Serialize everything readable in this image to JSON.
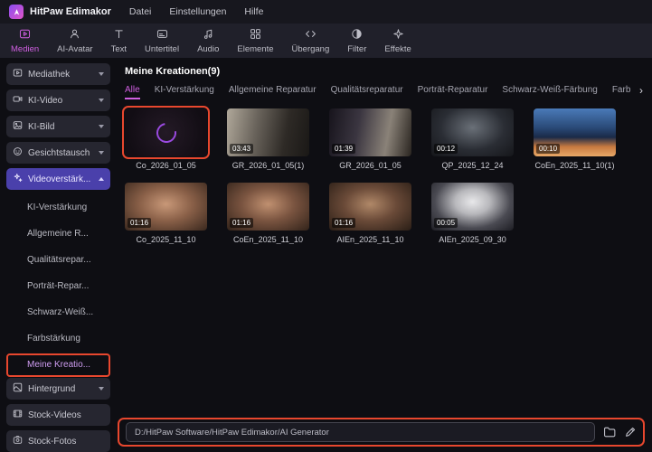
{
  "titlebar": {
    "app_name": "HitPaw Edimakor",
    "menus": [
      "Datei",
      "Einstellungen",
      "Hilfe"
    ]
  },
  "toolbar": {
    "tabs": [
      "Medien",
      "AI-Avatar",
      "Text",
      "Untertitel",
      "Audio",
      "Elemente",
      "Übergang",
      "Filter",
      "Effekte"
    ],
    "active_tab": "Medien"
  },
  "sidebar": {
    "items": [
      "Mediathek",
      "KI-Video",
      "KI-Bild",
      "Gesichtstausch",
      "Videoverstärk...",
      "Hintergrund",
      "Stock-Videos",
      "Stock-Fotos"
    ],
    "active_item": "Videoverstärk...",
    "sub_items": [
      "KI-Verstärkung",
      "Allgemeine R...",
      "Qualitätsrepar...",
      "Porträt-Repar...",
      "Schwarz-Weiß...",
      "Farbstärkung",
      "Meine Kreatio..."
    ],
    "selected_sub_item": "Meine Kreatio..."
  },
  "main": {
    "title": "Meine Kreationen(9)",
    "filter_tabs": [
      "Alle",
      "KI-Verstärkung",
      "Allgemeine Reparatur",
      "Qualitätsreparatur",
      "Porträt-Reparatur",
      "Schwarz-Weiß-Färbung",
      "Farb"
    ],
    "active_filter": "Alle",
    "scroll_more_indicator": "›",
    "items": [
      {
        "name": "Co_2026_01_05",
        "duration": "",
        "state": "processing"
      },
      {
        "name": "GR_2026_01_05(1)",
        "duration": "03:43"
      },
      {
        "name": "GR_2026_01_05",
        "duration": "01:39"
      },
      {
        "name": "QP_2025_12_24",
        "duration": "00:12"
      },
      {
        "name": "CoEn_2025_11_10(1)",
        "duration": "00:10"
      },
      {
        "name": "Co_2025_11_10",
        "duration": "01:16"
      },
      {
        "name": "CoEn_2025_11_10",
        "duration": "01:16"
      },
      {
        "name": "AIEn_2025_11_10",
        "duration": "01:16"
      },
      {
        "name": "AIEn_2025_09_30",
        "duration": "00:05"
      }
    ]
  },
  "bottombar": {
    "path": "D:/HitPaw Software/HitPaw Edimakor/AI Generator"
  },
  "colors": {
    "accent": "#cf5fe0",
    "annotation_highlight": "#e8472e",
    "active_sidebar_bg": "#4a40ab"
  }
}
